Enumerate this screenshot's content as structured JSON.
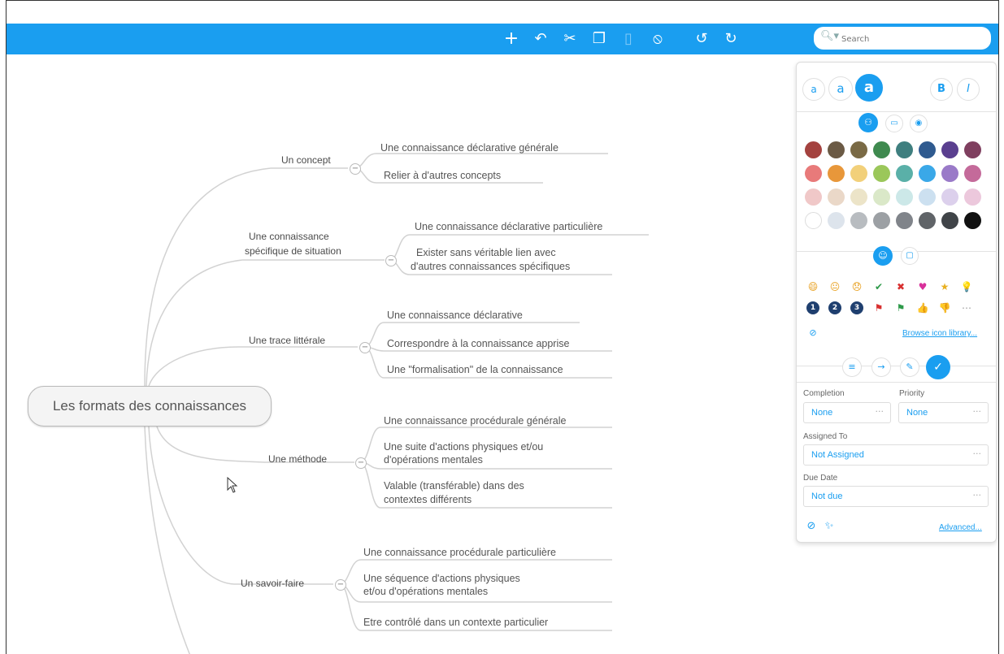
{
  "toolbar": {
    "add_icon": "+",
    "relation_icon": "↶",
    "cut_icon": "✂",
    "copy_icon": "❐",
    "paste_icon": "▯",
    "clear_icon": "⦸",
    "undo_icon": "↺",
    "redo_icon": "↻",
    "search_placeholder": "Search"
  },
  "map": {
    "root": "Les formats des connaissances",
    "branches": [
      {
        "label": "Un concept",
        "leaves": [
          "Une connaissance déclarative générale",
          "Relier à d'autres concepts"
        ]
      },
      {
        "label_lines": [
          "Une connaissance",
          "spécifique de situation"
        ],
        "leaves": [
          "Une connaissance déclarative particulière",
          "Exister sans véritable lien avec",
          "d'autres connaissances spécifiques"
        ]
      },
      {
        "label": "Une trace littérale",
        "leaves": [
          "Une connaissance déclarative",
          "Correspondre à la connaissance apprise",
          "Une \"formalisation\" de la connaissance"
        ]
      },
      {
        "label": "Une méthode",
        "leaves": [
          "Une connaissance procédurale générale",
          "Une suite d'actions physiques et/ou",
          "d'opérations mentales",
          "Valable (transférable) dans des",
          "contextes différents"
        ]
      },
      {
        "label": "Un savoir-faire",
        "leaves": [
          "Une connaissance procédurale particulière",
          "Une séquence d'actions physiques",
          "et/ou d'opérations mentales",
          "Etre contrôlé dans un contexte particulier"
        ]
      }
    ]
  },
  "panel": {
    "text_sizes": [
      "a",
      "a",
      "a"
    ],
    "bold": "B",
    "italic": "I",
    "colors": [
      [
        "#a4423f",
        "#6b5a45",
        "#7a6a45",
        "#3f8a4f",
        "#3f7f7f",
        "#2f5a8f",
        "#5a3f8f",
        "#7f3f5f"
      ],
      [
        "#e87a7a",
        "#e8973a",
        "#f2d07a",
        "#9bc75a",
        "#5ab0a8",
        "#3aa8e8",
        "#9a7ac8",
        "#c46a9a"
      ],
      [
        "#f0c8c8",
        "#ead8c8",
        "#ece4c8",
        "#dae8c8",
        "#cce8e8",
        "#cce0f0",
        "#dcd0ec",
        "#ecc8dc"
      ],
      [
        "#ffffff",
        "#dde4ec",
        "#b8bcc0",
        "#9ca0a4",
        "#80848a",
        "#606468",
        "#404448",
        "#111111"
      ]
    ],
    "icons_row1": [
      "😄",
      "😐",
      "😞",
      "✔",
      "✖",
      "♥",
      "★",
      "💡"
    ],
    "icons_row2": [
      "1",
      "2",
      "3",
      "⚑",
      "⚑",
      "👍",
      "👎",
      "⋯"
    ],
    "browse_link": "Browse icon library...",
    "completion_label": "Completion",
    "completion_value": "None",
    "priority_label": "Priority",
    "priority_value": "None",
    "assigned_label": "Assigned To",
    "assigned_value": "Not Assigned",
    "due_label": "Due Date",
    "due_value": "Not due",
    "advanced_link": "Advanced...",
    "dots": "···"
  }
}
